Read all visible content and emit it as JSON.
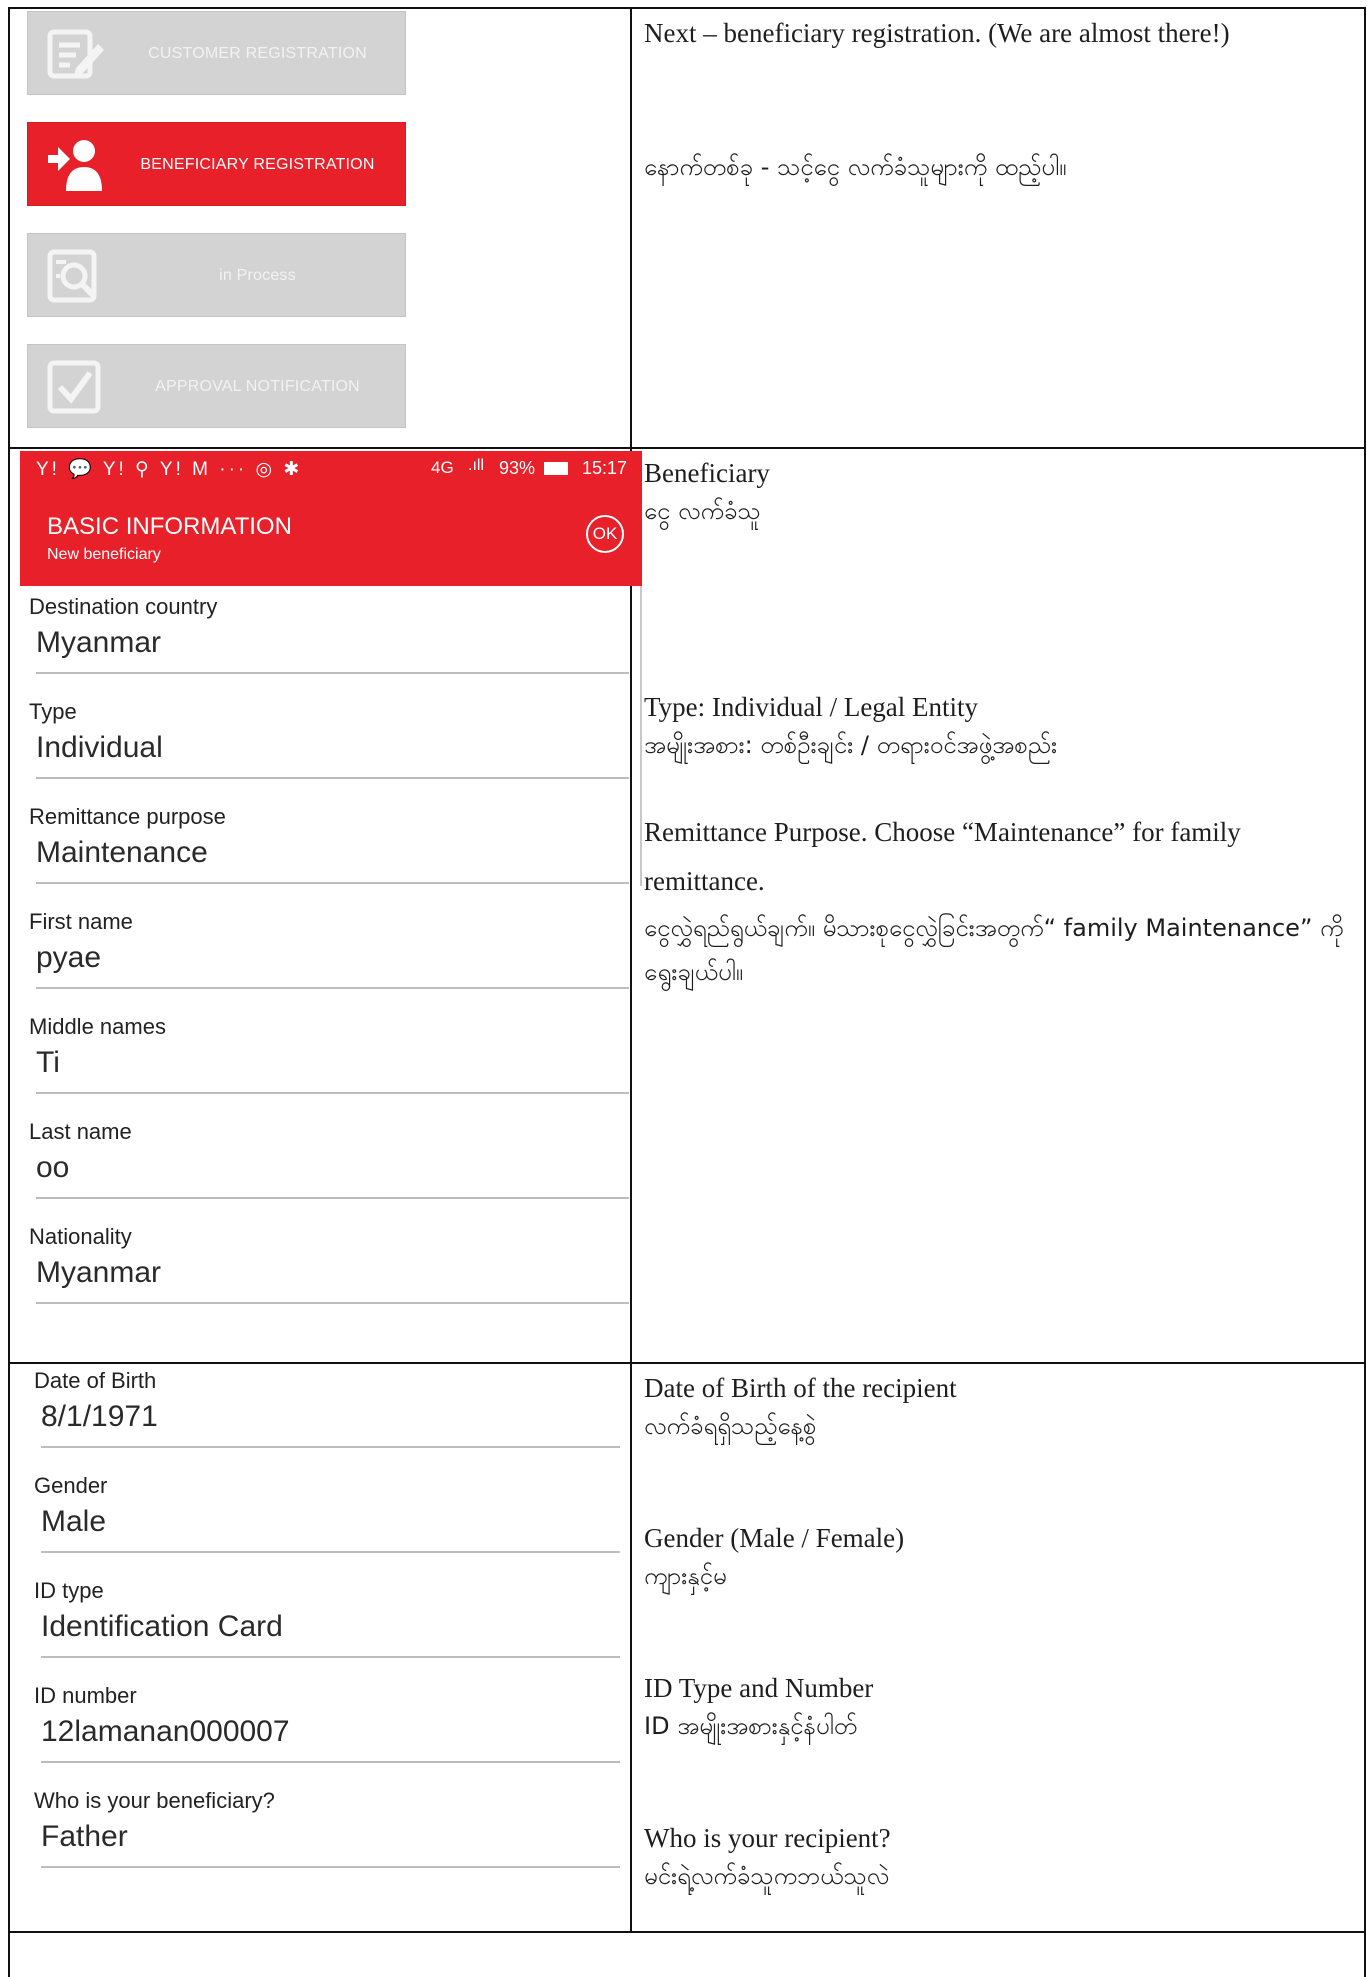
{
  "menu": {
    "items": [
      {
        "label": "CUSTOMER REGISTRATION",
        "icon": "edit-form-icon",
        "active": false
      },
      {
        "label": "BENEFICIARY REGISTRATION",
        "icon": "add-person-icon",
        "active": true
      },
      {
        "label": "in Process",
        "icon": "search-document-icon",
        "active": false
      },
      {
        "label": "APPROVAL NOTIFICATION",
        "icon": "checkbox-icon",
        "active": false
      }
    ]
  },
  "notes": {
    "row1": {
      "en": "Next – beneficiary registration.  (We are almost there!)",
      "mm": "နောက်တစ်ခု - သင့်ငွေ လက်ခံသူများကို ထည့်ပါ။"
    },
    "row2": {
      "beneficiary_en": "Beneficiary",
      "beneficiary_mm": "ငွေ လက်ခံသူ",
      "type_en": "Type: Individual / Legal Entity",
      "type_mm": "အမျိုးအစား: တစ်ဦးချင်း / တရားဝင်အဖွဲ့အစည်း",
      "purpose_en": "Remittance Purpose. Choose “Maintenance” for family remittance.",
      "purpose_mm": "ငွေလွှဲရည်ရွယ်ချက်။ မိသားစုငွေလွှဲခြင်းအတွက်“ family Maintenance” ကိုရွေးချယ်ပါ။"
    },
    "row3": {
      "dob_en": "Date of Birth of the recipient",
      "dob_mm": "လက်ခံရရှိသည့်နေ့စွဲ",
      "gender_en": "Gender (Male / Female)",
      "gender_mm": "ကျားနှင့်မ",
      "id_en": "ID Type and Number",
      "id_mm": "ID အမျိုးအစားနှင့်နံပါတ်",
      "who_en": "Who is your recipient?",
      "who_mm": "မင်းရဲ့လက်ခံသူကဘယ်သူလဲ"
    }
  },
  "status_bar": {
    "icons_text": "Y! 💬 Y! ⚲ Y! M ··· ◎ ✱",
    "network": "4G",
    "battery": "93%",
    "time": "15:17"
  },
  "app_bar": {
    "title": "BASIC INFORMATION",
    "subtitle": "New beneficiary",
    "ok_label": "OK"
  },
  "form1": [
    {
      "label": "Destination country",
      "value": "Myanmar"
    },
    {
      "label": "Type",
      "value": "Individual"
    },
    {
      "label": "Remittance purpose",
      "value": "Maintenance"
    },
    {
      "label": "First name",
      "value": "pyae"
    },
    {
      "label": "Middle names",
      "value": "Ti"
    },
    {
      "label": "Last name",
      "value": "oo"
    },
    {
      "label": "Nationality",
      "value": "Myanmar"
    }
  ],
  "form2": [
    {
      "label": "Date of Birth",
      "value": "8/1/1971"
    },
    {
      "label": "Gender",
      "value": "Male"
    },
    {
      "label": "ID type",
      "value": "Identification Card"
    },
    {
      "label": "ID number",
      "value": "12lamanan000007"
    },
    {
      "label": "Who is your beneficiary?",
      "value": "Father"
    }
  ],
  "colors": {
    "accent": "#e8202a",
    "disabled": "#d3d3d3"
  }
}
